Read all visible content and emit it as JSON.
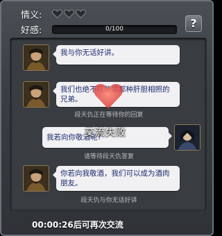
{
  "header": {
    "affection_label": "情义:",
    "goodwill_label": "好感:",
    "hearts": [
      0,
      0,
      0
    ],
    "favor_value": 0,
    "favor_max": 100,
    "favor_text": "0/100",
    "help_label": "?"
  },
  "chat": {
    "messages": [
      {
        "side": "left",
        "text": "我与你无话好讲。"
      },
      {
        "side": "left",
        "text": "我们也绝不可能是那种肝胆相照的兄弟。"
      },
      {
        "side": "system",
        "text": "段天仇正在等待你的回复"
      },
      {
        "side": "right",
        "text": "我若向你敬酒呢?"
      },
      {
        "side": "system",
        "text": "请等待段天仇答复"
      },
      {
        "side": "left",
        "text": "你若向我敬酒，我们可以成为酒肉朋友。"
      },
      {
        "side": "system",
        "text": "段天仇与你无话好讲"
      }
    ]
  },
  "overlay": {
    "fail_text": "交流失败"
  },
  "footer": {
    "timer_text": "00:00:26后可再次交流"
  },
  "colors": {
    "bubble_text": "#1e2a6e",
    "favor_fill": "#cc3333",
    "heart_overlay": "#e23a3a"
  }
}
